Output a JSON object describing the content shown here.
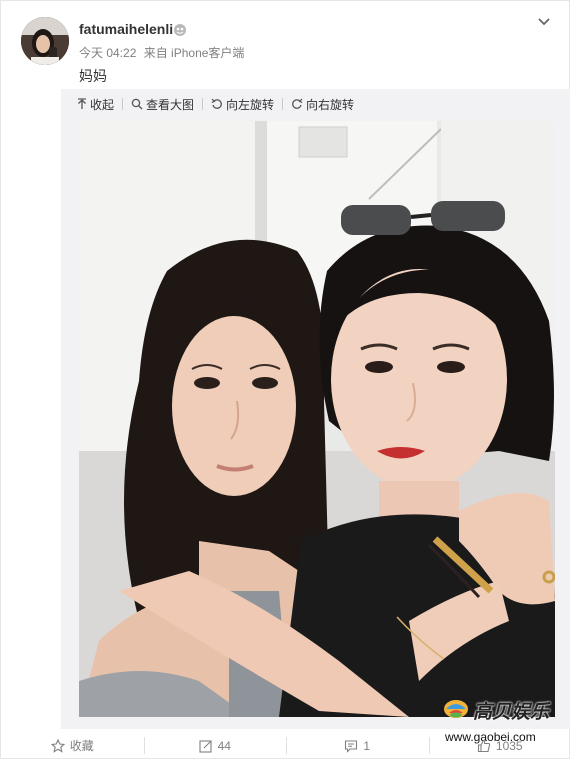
{
  "post": {
    "username": "fatumaihelenli",
    "time": "今天 04:22",
    "source": "来自 iPhone客户端",
    "text": "妈妈"
  },
  "media_toolbar": {
    "collapse": "收起",
    "view_large": "查看大图",
    "rotate_left": "向左旋转",
    "rotate_right": "向右旋转"
  },
  "watermark": {
    "brand": "高贝娱乐",
    "url": "www.gaobei.com"
  },
  "actions": {
    "favorite": "收藏",
    "repost_count": "44",
    "comment_count": "1",
    "like_count": "1035"
  },
  "icons": [
    "vip-badge-icon",
    "chevron-down-icon",
    "collapse-icon",
    "search-icon",
    "rotate-left-icon",
    "rotate-right-icon",
    "star-icon",
    "repost-icon",
    "comment-icon",
    "like-icon"
  ],
  "colors": {
    "meta_text": "#808080",
    "panel_bg": "#f2f2f5",
    "text": "#333333"
  }
}
